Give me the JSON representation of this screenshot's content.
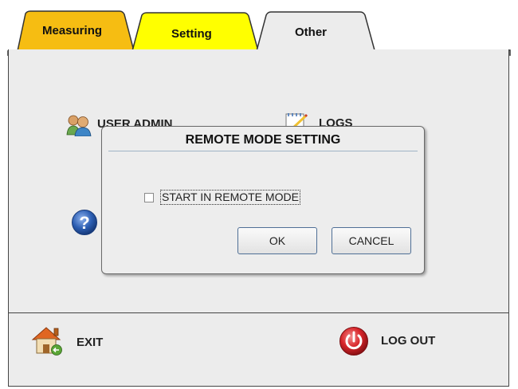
{
  "tabs": [
    {
      "label": "Measuring",
      "color": "#f6bd12"
    },
    {
      "label": "Setting",
      "color": "#ffff00"
    },
    {
      "label": "Other",
      "color": "#ececec",
      "active": true
    }
  ],
  "main": {
    "items": [
      {
        "label": "USER ADMIN",
        "icon": "users-icon"
      },
      {
        "label": "LOGS",
        "icon": "notepad-icon"
      },
      {
        "label": "",
        "icon": "help-icon"
      }
    ]
  },
  "dialog": {
    "title": "REMOTE MODE SETTING",
    "checkbox_label": "START IN REMOTE MODE",
    "checkbox_checked": false,
    "ok_label": "OK",
    "cancel_label": "CANCEL"
  },
  "footer": {
    "exit_label": "EXIT",
    "logout_label": "LOG OUT"
  },
  "colors": {
    "panel": "#ececec",
    "button_border": "#4f6f96",
    "logout_red": "#d8262b",
    "help_blue": "#2d5fb3"
  }
}
